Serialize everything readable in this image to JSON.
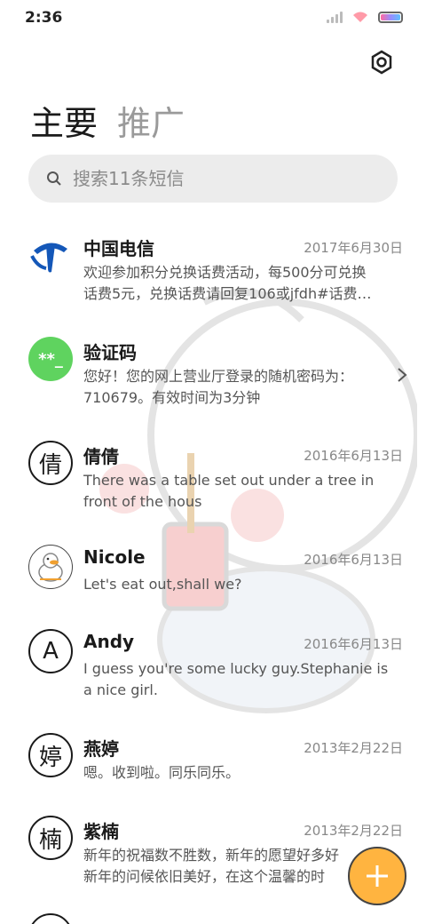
{
  "status_bar": {
    "time": "2:36"
  },
  "tabs": [
    {
      "label": "主要"
    },
    {
      "label": "推广"
    }
  ],
  "search": {
    "placeholder": "搜索11条短信"
  },
  "messages": [
    {
      "name": "中国电信",
      "date": "2017年6月30日",
      "line1": "欢迎参加积分兑换话费活动，每500分可兑换",
      "line2": "话费5元，兑换话费请回复106或jfdh#话费…",
      "avatar": "china-telecom-logo"
    },
    {
      "name": "验证码",
      "date": "",
      "line1": "您好！您的网上营业厅登录的随机密码为：",
      "line2": "710679。有效时间为3分钟",
      "avatar_text": "**_"
    },
    {
      "name": "倩倩",
      "date": "2016年6月13日",
      "line1": "There was a table set out under a tree in",
      "line2": "front of the hous",
      "avatar_text": "倩"
    },
    {
      "name": "Nicole",
      "date": "2016年6月13日",
      "line1": "Let's eat out,shall we?",
      "line2": "",
      "avatar": "duck-avatar"
    },
    {
      "name": "Andy",
      "date": "2016年6月13日",
      "line1": "I guess you're some lucky guy.Stephanie is",
      "line2": "a nice girl.",
      "avatar_text": "A"
    },
    {
      "name": "燕婷",
      "date": "2013年2月22日",
      "line1": "嗯。收到啦。同乐同乐。",
      "line2": "",
      "avatar_text": "婷"
    },
    {
      "name": "紫楠",
      "date": "2013年2月22日",
      "line1": "新年的祝福数不胜数，新年的愿望好多好",
      "line2": "新年的问候依旧美好，在这个温馨的时",
      "avatar_text": "楠"
    }
  ],
  "colors": {
    "accent_fab": "#ffb440",
    "verify_avatar": "#5fd35f",
    "telecom_blue": "#1457b8"
  },
  "icons": [
    "gear-icon",
    "search-icon",
    "chevron-right-icon",
    "plus-icon"
  ]
}
